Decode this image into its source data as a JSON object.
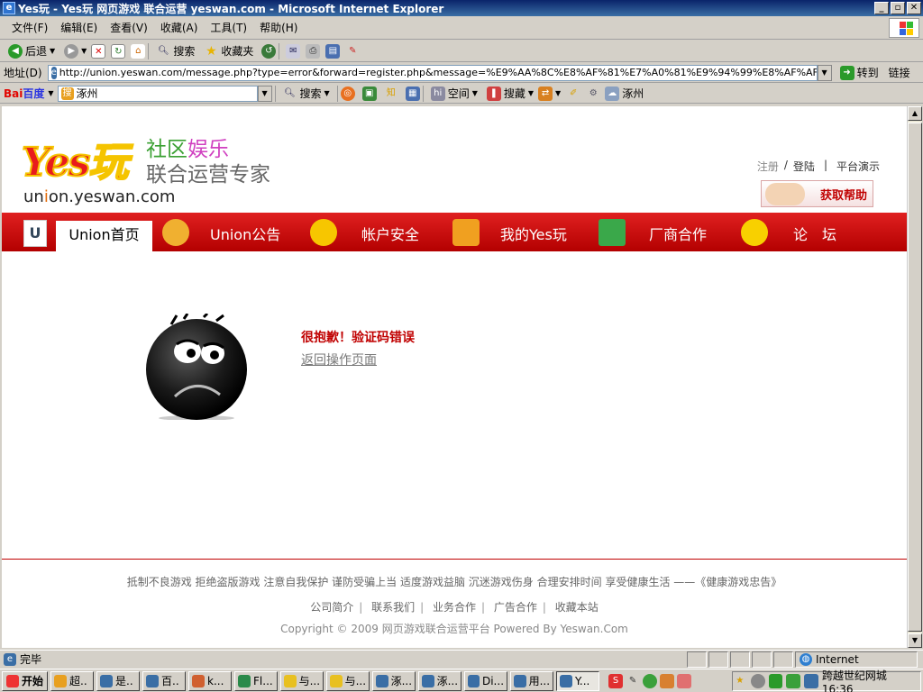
{
  "window": {
    "title": "Yes玩 - Yes玩 网页游戏 联合运营 yeswan.com - Microsoft Internet Explorer"
  },
  "menu": [
    "文件(F)",
    "编辑(E)",
    "查看(V)",
    "收藏(A)",
    "工具(T)",
    "帮助(H)"
  ],
  "toolbar": {
    "back": "后退",
    "search": "搜索",
    "favorites": "收藏夹"
  },
  "address": {
    "label": "地址(D)",
    "url": "http://union.yeswan.com/message.php?type=error&forward=register.php&message=%E9%AA%8C%E8%AF%81%E7%A0%81%E9%94%99%E8%AF%AF",
    "go": "转到",
    "links": "链接"
  },
  "baidu": {
    "logo_bai": "Bai",
    "logo_du": "百度",
    "query": "涿州",
    "search": "搜索",
    "space": "空间",
    "collect": "搜藏",
    "city": "涿州"
  },
  "site": {
    "logo_text": "Yes玩",
    "slogan_1a": "社区",
    "slogan_1b": "娱乐",
    "slogan_2": "联合运营专家",
    "url_u": "un",
    "url_i": "i",
    "url_rest": "on.yeswan.com",
    "register": "注册",
    "login_sep": "/",
    "login": "登陆",
    "demo_sep": "|",
    "demo": "平台演示",
    "help": "获取帮助"
  },
  "nav": {
    "u_icon": "U",
    "home": "Union首页",
    "items": [
      "Union公告",
      "帐户安全",
      "我的Yes玩",
      "厂商合作",
      "论　坛"
    ],
    "colors": [
      "#f0b030",
      "#f7c600",
      "#f0a020",
      "#3aa84a",
      "#f8d000"
    ]
  },
  "message": {
    "title": "很抱歉！验证码错误",
    "back_link": "返回操作页面"
  },
  "footer": {
    "line1": "抵制不良游戏 拒绝盗版游戏 注意自我保护 谨防受骗上当 适度游戏益脑 沉迷游戏伤身 合理安排时间 享受健康生活 ——《健康游戏忠告》",
    "links": [
      "公司简介",
      "联系我们",
      "业务合作",
      "广告合作",
      "收藏本站"
    ],
    "link_sep": "|",
    "copyright": "Copyright © 2009 网页游戏联合运营平台 Powered By Yeswan.Com"
  },
  "status": {
    "text": "完毕",
    "zone": "Internet"
  },
  "taskbar": {
    "start": "开始",
    "tasks": [
      "超..",
      "是..",
      "百..",
      "k...",
      "Fl...",
      "与...",
      "与...",
      "涿...",
      "涿...",
      "Di...",
      "用...",
      "Y..."
    ],
    "tray_text": "跨越世纪网城16:36"
  }
}
